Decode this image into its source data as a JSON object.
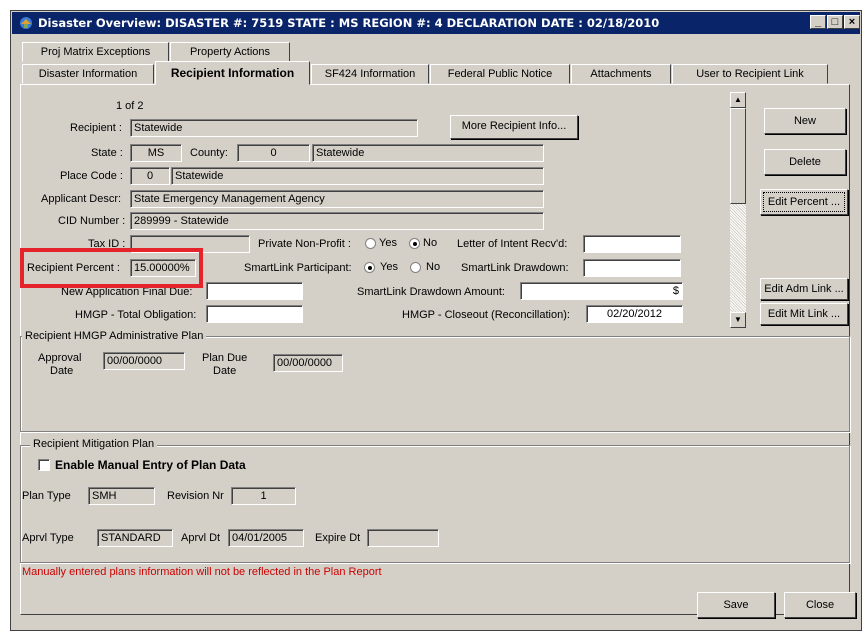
{
  "window": {
    "title": "Disaster Overview:  DISASTER #: 7519   STATE : MS   REGION #: 4   DECLARATION DATE : 02/18/2010",
    "min_label": "_",
    "max_label": "□",
    "close_label": "×"
  },
  "tabs_row1": [
    {
      "label": "Proj Matrix Exceptions"
    },
    {
      "label": "Property Actions"
    }
  ],
  "tabs_row2": [
    {
      "label": "Disaster Information"
    },
    {
      "label": "Recipient  Information"
    },
    {
      "label": "SF424  Information"
    },
    {
      "label": "Federal Public Notice"
    },
    {
      "label": "Attachments"
    },
    {
      "label": "User to Recipient Link"
    }
  ],
  "recipient": {
    "record_counter": "1 of 2",
    "recipient_label": "Recipient :",
    "recipient_value": "Statewide",
    "more_info_button": "More Recipient Info...",
    "state_label": "State :",
    "state_value": "MS",
    "county_label": "County:",
    "county_code": "0",
    "county_name": "Statewide",
    "place_code_label": "Place Code :",
    "place_code": "0",
    "place_name": "Statewide",
    "applicant_descr_label": "Applicant Descr:",
    "applicant_descr_value": "State Emergency Management Agency",
    "cid_label": "CID Number :",
    "cid_value": "289999 - Statewide",
    "tax_id_label": "Tax ID :",
    "tax_id_value": "",
    "private_nonprofit_label": "Private Non-Profit :",
    "pnp_yes": "Yes",
    "pnp_no": "No",
    "pnp_selected": "No",
    "letter_intent_label": "Letter of Intent Recv'd:",
    "letter_intent_value": "",
    "recipient_percent_label": "Recipient Percent :",
    "recipient_percent_value": "15.00000%",
    "smartlink_participant_label": "SmartLink Participant:",
    "sl_yes": "Yes",
    "sl_no": "No",
    "sl_selected": "Yes",
    "smartlink_drawdown_label": "SmartLink Drawdown:",
    "smartlink_drawdown_value": "",
    "new_app_final_due_label": "New Application Final Due:",
    "new_app_final_due_value": "",
    "smartlink_drawdown_amount_label": "SmartLink Drawdown Amount:",
    "smartlink_drawdown_amount_value": "$",
    "hmgp_total_obligation_label": "HMGP - Total Obligation:",
    "hmgp_total_obligation_value": "",
    "hmgp_closeout_label": "HMGP - Closeout (Reconcillation):",
    "hmgp_closeout_value": "02/20/2012"
  },
  "side_buttons": {
    "new": "New",
    "delete": "Delete",
    "edit_percent": "Edit Percent ...",
    "edit_adm_link": "Edit Adm Link ...",
    "edit_mit_link": "Edit Mit Link ..."
  },
  "admin_plan": {
    "title": "Recipient HMGP Administrative Plan",
    "approval_label_1": "Approval",
    "approval_label_2": "Date",
    "approval_value": "00/00/0000",
    "plan_due_label_1": "Plan Due",
    "plan_due_label_2": "Date",
    "plan_due_value": "00/00/0000"
  },
  "mitigation_plan": {
    "title": "Recipient Mitigation Plan",
    "enable_manual_label": "Enable Manual Entry of Plan Data",
    "plan_type_label": "Plan Type",
    "plan_type_value": "SMH",
    "revision_label": "Revision Nr",
    "revision_value": "1",
    "aprvl_type_label": "Aprvl Type",
    "aprvl_type_value": "STANDARD",
    "aprvl_dt_label": "Aprvl Dt",
    "aprvl_dt_value": "04/01/2005",
    "expire_dt_label": "Expire Dt",
    "expire_dt_value": ""
  },
  "note": "Manually entered plans information will not be reflected in the Plan Report",
  "footer": {
    "save": "Save",
    "close": "Close"
  },
  "colors": {
    "highlight": "#e4242a",
    "titlebar": "#0a246a",
    "note": "#cc0000"
  }
}
